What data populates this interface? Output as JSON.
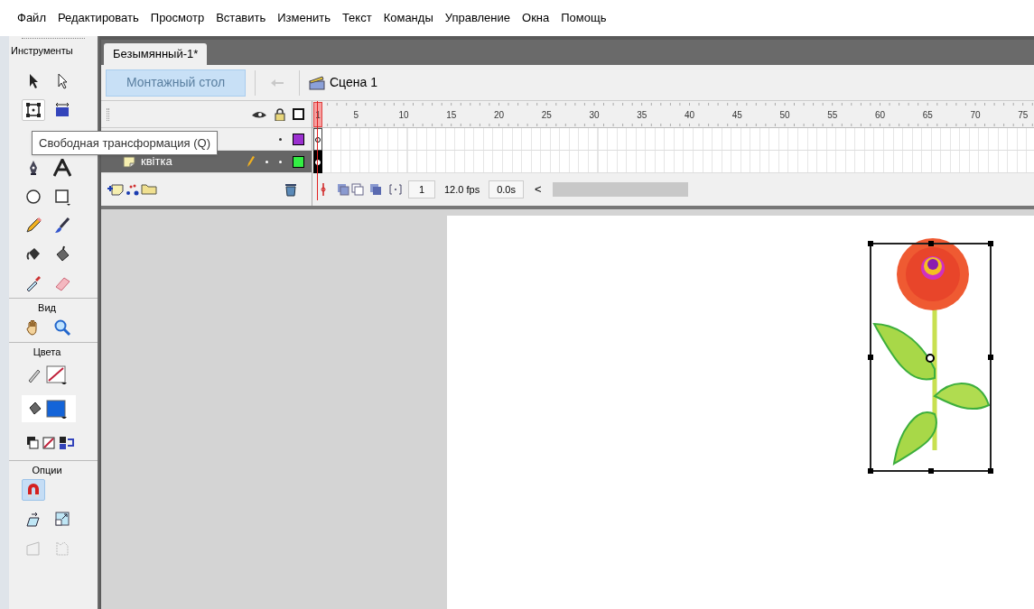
{
  "menu": [
    "Файл",
    "Редактировать",
    "Просмотр",
    "Вставить",
    "Изменить",
    "Текст",
    "Команды",
    "Управление",
    "Окна",
    "Помощь"
  ],
  "toolbox": {
    "title": "Инструменты",
    "sections": [
      {
        "tools": [
          {
            "kind": "arrow",
            "selected": false
          },
          {
            "kind": "subselect",
            "selected": false
          },
          {
            "kind": "transform",
            "selected": true
          },
          {
            "kind": "gradient",
            "selected": false
          },
          {
            "kind": "pen",
            "selected": false
          },
          {
            "kind": "text",
            "selected": false
          },
          {
            "kind": "oval",
            "selected": false
          },
          {
            "kind": "rect",
            "selected": false
          },
          {
            "kind": "pencil",
            "selected": false
          },
          {
            "kind": "brush",
            "selected": false
          },
          {
            "kind": "inkbottle",
            "selected": false
          },
          {
            "kind": "bucket",
            "selected": false
          },
          {
            "kind": "eyedropper",
            "selected": false
          },
          {
            "kind": "eraser",
            "selected": false
          }
        ]
      },
      {
        "title": "Вид",
        "tools": [
          {
            "kind": "hand",
            "selected": false
          },
          {
            "kind": "zoom",
            "selected": false
          }
        ]
      },
      {
        "title": "Цвета",
        "tools": [
          {
            "kind": "stroke"
          },
          {
            "kind": "fill"
          },
          {
            "kind": "swap"
          }
        ]
      },
      {
        "title": "Опции",
        "tools": [
          {
            "kind": "magnet",
            "selected": true
          },
          {
            "kind": "rotate",
            "selected": false
          },
          {
            "kind": "scale",
            "selected": false
          },
          {
            "kind": "distort",
            "selected": false
          },
          {
            "kind": "envelope",
            "selected": false
          }
        ]
      }
    ]
  },
  "tooltip": "Свободная трансформация (Q)",
  "document_tab": {
    "label": "Безымянный-1*",
    "selected": true
  },
  "edit_bar": {
    "timeline_button": "Монтажный стол",
    "scene": "Сцена 1"
  },
  "timeline": {
    "layers": [
      {
        "color": "#9b30d0",
        "selected": false
      },
      {
        "name": "квітка",
        "color": "#33ee44",
        "selected": true
      }
    ],
    "ruler": [
      "1",
      "5",
      "10",
      "15",
      "20",
      "25",
      "30",
      "35",
      "40",
      "45",
      "50",
      "55",
      "60",
      "65",
      "70",
      "75"
    ],
    "current_frame": "1",
    "fps": "12.0 fps",
    "time": "0.0s",
    "scroll_left": "<"
  }
}
